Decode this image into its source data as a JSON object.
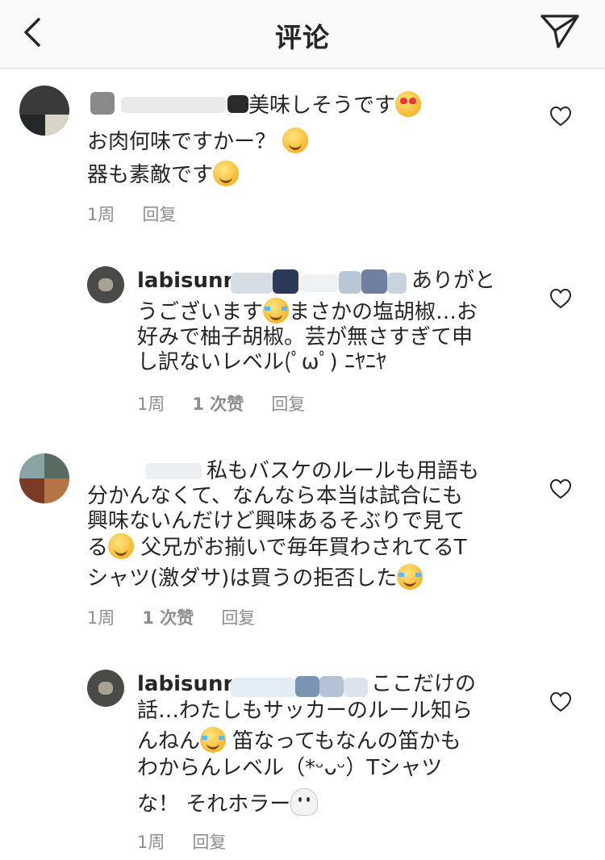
{
  "header": {
    "title": "评论"
  },
  "comments": [
    {
      "line1_suffix": "美味しそうです",
      "line2": "お肉何味ですかー？",
      "line3": "器も素敵です",
      "time": "1周",
      "reply": "回复"
    },
    {
      "username": "labisunn",
      "line1_suffix": "ありがと",
      "line2_prefix": "うございます",
      "line2_suffix": "まさかの塩胡椒…お",
      "line3": "好みで柚子胡椒。芸が無さすぎて申",
      "line4": "し訳ないレベル(ﾟωﾟ) ﾆﾔﾆﾔ",
      "time": "1周",
      "likes": "1 次赞",
      "reply": "回复"
    },
    {
      "line1_suffix": "私もバスケのルールも用語も",
      "line2": "分かんなくて、なんなら本当は試合にも",
      "line3": "興味ないんだけど興味あるそぶりで見て",
      "line4_prefix": "る",
      "line4_suffix": "父兄がお揃いで毎年買わされてるT",
      "line5": "シャツ(激ダサ)は買うの拒否した",
      "time": "1周",
      "likes": "1 次赞",
      "reply": "回复"
    },
    {
      "username": "labisunn",
      "line1_suffix": "ここだけの",
      "line2": "話…わたしもサッカーのルール知ら",
      "line3_prefix": "んねん",
      "line3_suffix": "笛なってもなんの笛かも",
      "line4": "わからんレベル（*ᵕᴗᵕ）Tシャツ",
      "line5": "な！ それホラー",
      "time": "1周",
      "reply": "回复"
    }
  ],
  "icons": {
    "back": "chevron-left-icon",
    "share": "paper-plane-icon",
    "like": "heart-outline-icon"
  },
  "colors": {
    "text": "#262626",
    "meta": "#8e8e8e",
    "header_bg": "#fafafa",
    "divider": "#dbdbdb"
  }
}
